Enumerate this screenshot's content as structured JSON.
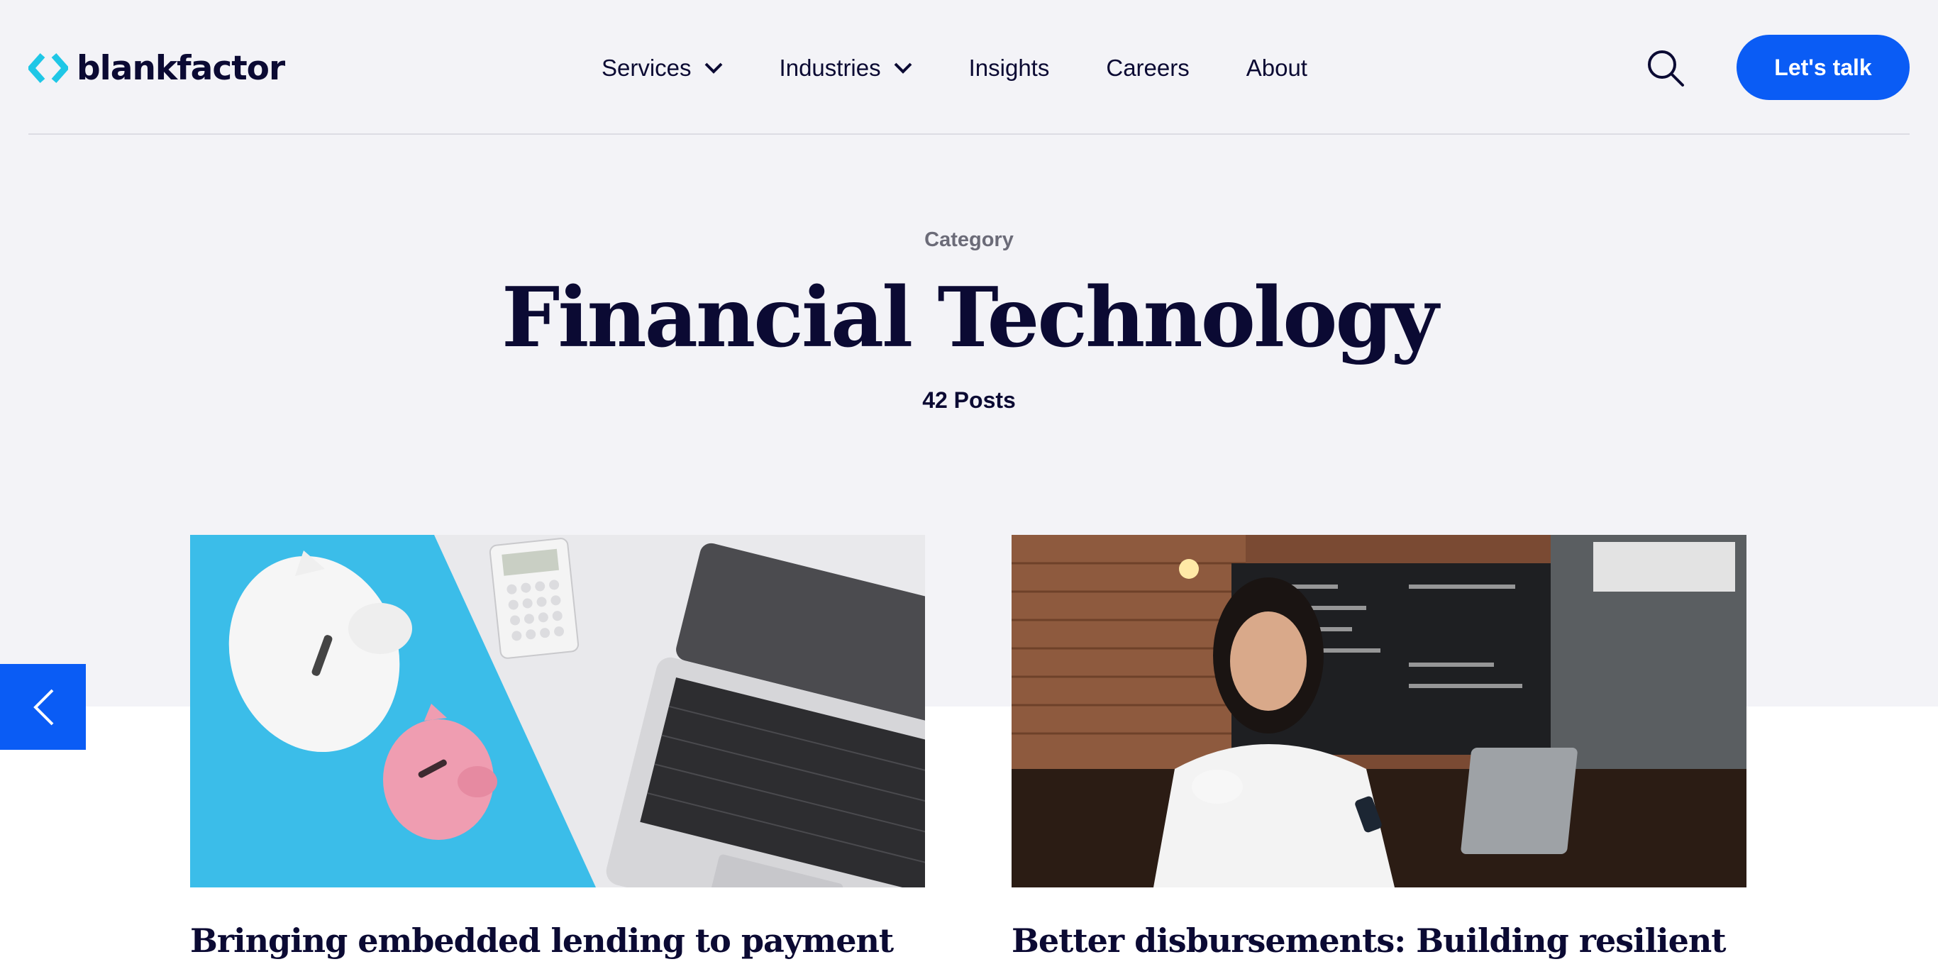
{
  "brand": {
    "name": "blankfactor",
    "accent": "#0a5cf5",
    "logo_cyan": "#1fc7e6",
    "ink": "#0b0a33"
  },
  "nav": {
    "items": [
      {
        "label": "Services",
        "dropdown": true
      },
      {
        "label": "Industries",
        "dropdown": true
      },
      {
        "label": "Insights",
        "dropdown": false
      },
      {
        "label": "Careers",
        "dropdown": false
      },
      {
        "label": "About",
        "dropdown": false
      }
    ],
    "search_icon": "search-icon",
    "cta_label": "Let's talk"
  },
  "hero": {
    "eyebrow": "Category",
    "title": "Financial Technology",
    "count": "42 Posts"
  },
  "carousel": {
    "prev_icon": "chevron-left-icon"
  },
  "posts": [
    {
      "title": "Bringing embedded lending to payment companies and software",
      "image": "piggy-banks-calculator-laptop"
    },
    {
      "title": "Better disbursements: Building resilient merchant payouts",
      "image": "woman-cafe-phone-laptop"
    }
  ]
}
